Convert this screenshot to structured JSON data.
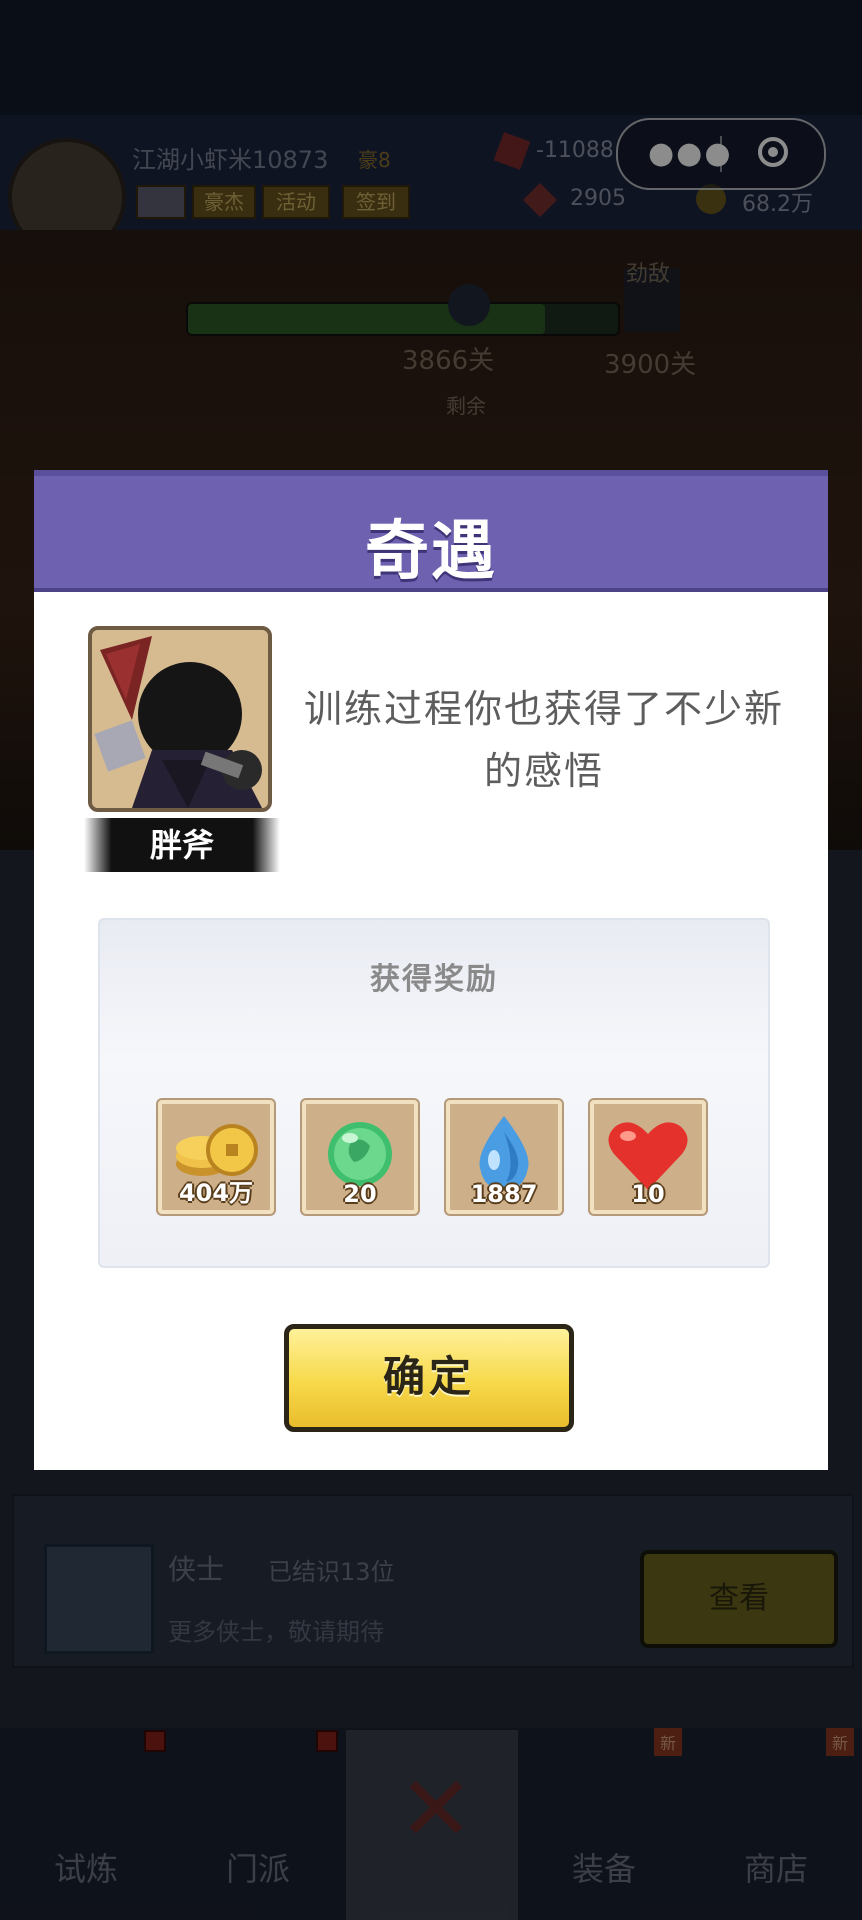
{
  "mini_program_menu": {
    "more_icon": "more-dots-icon",
    "close_icon": "target-circle-icon"
  },
  "background": {
    "player_name": "江湖小虾米10873",
    "vip_label": "豪8",
    "tags": [
      "豪杰",
      "活动",
      "签到"
    ],
    "resource_gem": "-11088",
    "resource_token": "2905",
    "resource_coins": "68.2万",
    "stage_current": "3866关",
    "stage_next": "3900关",
    "boss_label": "劲敌",
    "remaining_label": "剩余",
    "progress_fraction": 0.83,
    "row": {
      "title": "侠士",
      "count_text": "已结识13位",
      "subtitle": "更多侠士，敬请期待",
      "view_button": "查看"
    },
    "nav": [
      {
        "label": "试炼",
        "badge": "dot"
      },
      {
        "label": "门派",
        "badge": "dot"
      },
      {
        "label": "",
        "badge": ""
      },
      {
        "label": "装备",
        "badge": "新"
      },
      {
        "label": "商店",
        "badge": "新"
      }
    ]
  },
  "modal": {
    "title": "奇遇",
    "character_name": "胖斧",
    "description": "训练过程你也获得了不少新的感悟",
    "reward_title": "获得奖励",
    "rewards": [
      {
        "icon": "gold-coins-icon",
        "count": "404万"
      },
      {
        "icon": "green-orb-icon",
        "count": "20"
      },
      {
        "icon": "water-drop-icon",
        "count": "1887"
      },
      {
        "icon": "heart-icon",
        "count": "10"
      }
    ],
    "confirm_button": "确定"
  },
  "colors": {
    "modal_header": "#6e62b0",
    "confirm_button": "#f7d94a",
    "heart": "#e4312b",
    "drop": "#4a9de2",
    "orb": "#3fbf6e"
  }
}
